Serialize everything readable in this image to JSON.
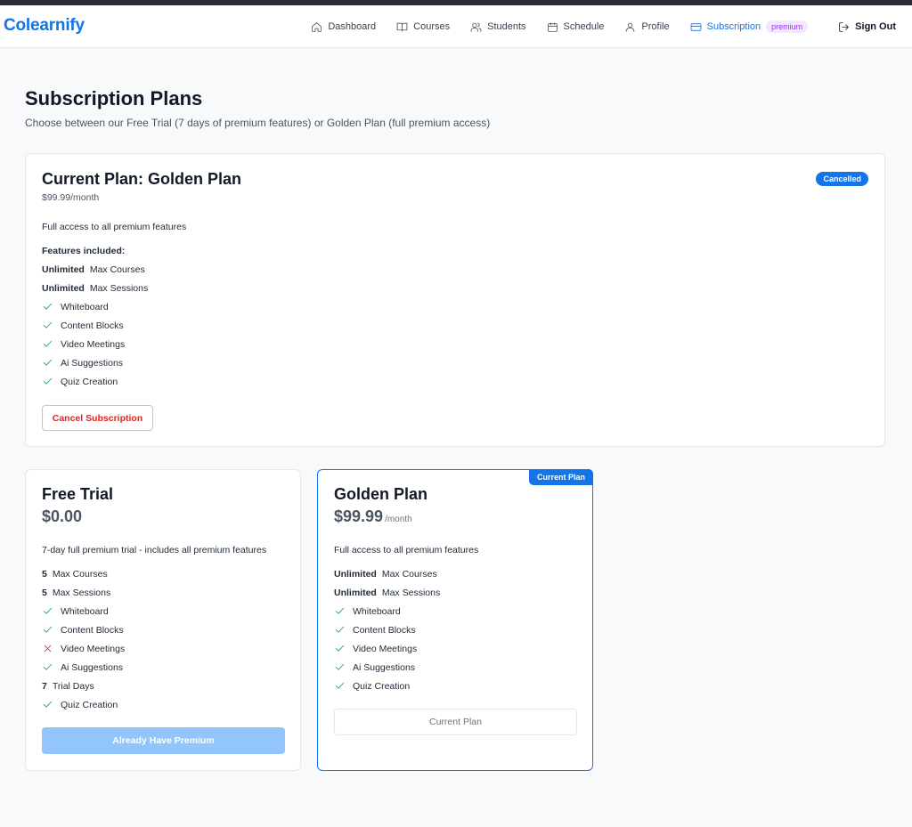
{
  "brand": "Colearnify",
  "nav": {
    "items": [
      {
        "label": "Dashboard",
        "icon": "home-icon"
      },
      {
        "label": "Courses",
        "icon": "book-icon"
      },
      {
        "label": "Students",
        "icon": "users-icon"
      },
      {
        "label": "Schedule",
        "icon": "calendar-icon"
      },
      {
        "label": "Profile",
        "icon": "user-icon"
      },
      {
        "label": "Subscription",
        "icon": "credit-card-icon",
        "badge": "premium",
        "active": true
      }
    ],
    "signout": "Sign Out"
  },
  "header": {
    "title": "Subscription Plans",
    "subtitle": "Choose between our Free Trial (7 days of premium features) or Golden Plan (full premium access)"
  },
  "current_plan": {
    "title": "Current Plan: Golden Plan",
    "price": "$99.99/month",
    "status": "Cancelled",
    "description": "Full access to all premium features",
    "features_label": "Features included:",
    "features": [
      {
        "type": "value",
        "value": "Unlimited",
        "label": "Max Courses"
      },
      {
        "type": "value",
        "value": "Unlimited",
        "label": "Max Sessions"
      },
      {
        "type": "check",
        "label": "Whiteboard"
      },
      {
        "type": "check",
        "label": "Content Blocks"
      },
      {
        "type": "check",
        "label": "Video Meetings"
      },
      {
        "type": "check",
        "label": "Ai Suggestions"
      },
      {
        "type": "check",
        "label": "Quiz Creation"
      }
    ],
    "cancel_label": "Cancel Subscription"
  },
  "plans": {
    "free": {
      "name": "Free Trial",
      "price": "$0.00",
      "description": "7-day full premium trial - includes all premium features",
      "features": [
        {
          "type": "value",
          "value": "5",
          "label": "Max Courses"
        },
        {
          "type": "value",
          "value": "5",
          "label": "Max Sessions"
        },
        {
          "type": "check",
          "label": "Whiteboard"
        },
        {
          "type": "check",
          "label": "Content Blocks"
        },
        {
          "type": "cross",
          "label": "Video Meetings"
        },
        {
          "type": "check",
          "label": "Ai Suggestions"
        },
        {
          "type": "value",
          "value": "7",
          "label": "Trial Days"
        },
        {
          "type": "check",
          "label": "Quiz Creation"
        }
      ],
      "button_label": "Already Have Premium"
    },
    "golden": {
      "name": "Golden Plan",
      "price": "$99.99",
      "period": "/month",
      "ribbon": "Current Plan",
      "description": "Full access to all premium features",
      "features": [
        {
          "type": "value",
          "value": "Unlimited",
          "label": "Max Courses"
        },
        {
          "type": "value",
          "value": "Unlimited",
          "label": "Max Sessions"
        },
        {
          "type": "check",
          "label": "Whiteboard"
        },
        {
          "type": "check",
          "label": "Content Blocks"
        },
        {
          "type": "check",
          "label": "Video Meetings"
        },
        {
          "type": "check",
          "label": "Ai Suggestions"
        },
        {
          "type": "check",
          "label": "Quiz Creation"
        }
      ],
      "button_label": "Current Plan"
    }
  },
  "colors": {
    "accent": "#1574e6",
    "check": "#16a34a",
    "cross": "#dc2626",
    "cancel": "#dc2626",
    "premium_badge": "#9333ea"
  }
}
